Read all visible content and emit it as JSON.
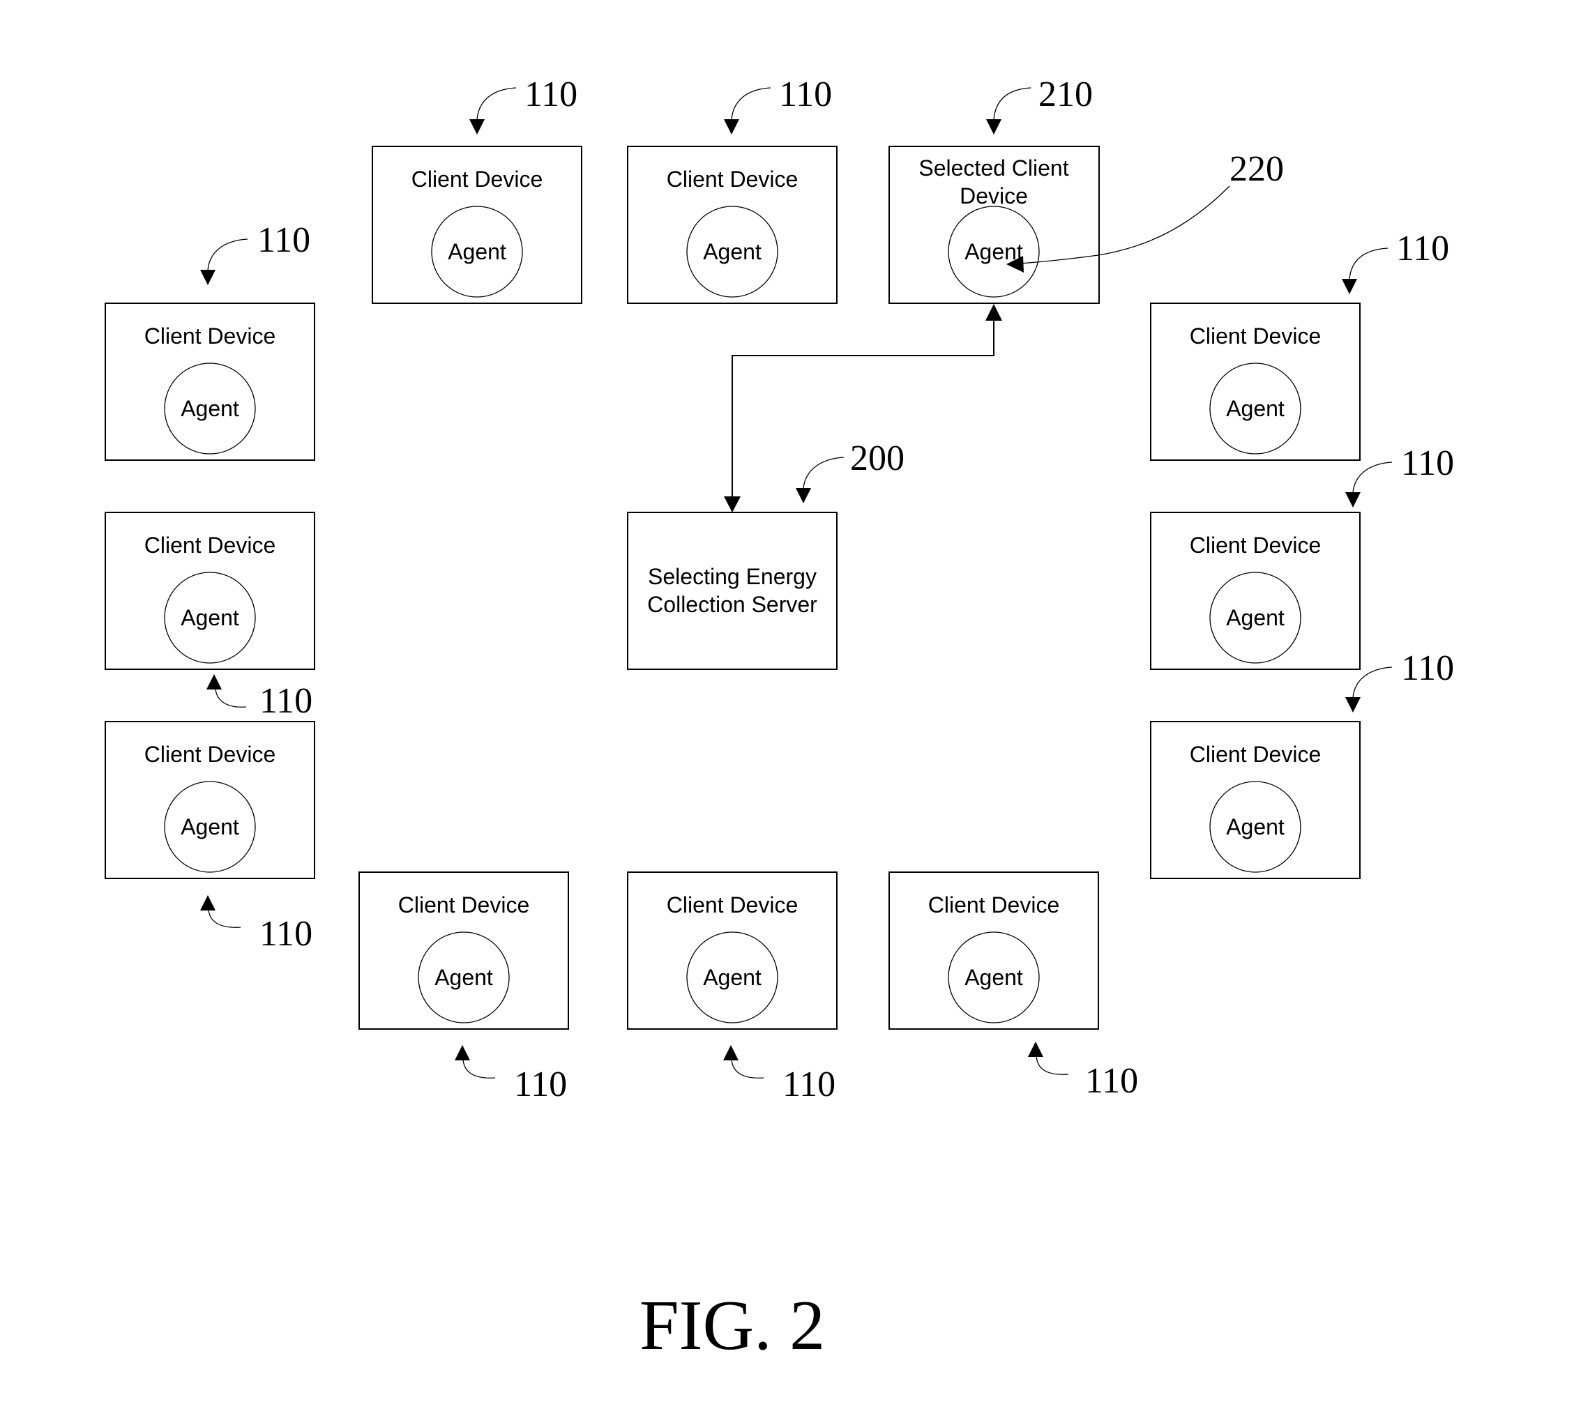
{
  "figure": {
    "caption": "FIG. 2"
  },
  "server": {
    "ref": "200",
    "label_lines": [
      "Selecting Energy",
      "Collection Server"
    ]
  },
  "selected_device": {
    "ref": "210",
    "label_lines": [
      "Selected Client",
      "Device"
    ],
    "agent_label": "Agent",
    "agent_ref": "220"
  },
  "client_devices": [
    {
      "id": "top-1",
      "ref": "110",
      "label": "Client Device",
      "agent_label": "Agent"
    },
    {
      "id": "top-2",
      "ref": "110",
      "label": "Client Device",
      "agent_label": "Agent"
    },
    {
      "id": "left-1",
      "ref": "110",
      "label": "Client Device",
      "agent_label": "Agent"
    },
    {
      "id": "left-2",
      "ref": "110",
      "label": "Client Device",
      "agent_label": "Agent"
    },
    {
      "id": "left-3",
      "ref": "110",
      "label": "Client Device",
      "agent_label": "Agent"
    },
    {
      "id": "right-1",
      "ref": "110",
      "label": "Client Device",
      "agent_label": "Agent"
    },
    {
      "id": "right-2",
      "ref": "110",
      "label": "Client Device",
      "agent_label": "Agent"
    },
    {
      "id": "right-3",
      "ref": "110",
      "label": "Client Device",
      "agent_label": "Agent"
    },
    {
      "id": "bottom-1",
      "ref": "110",
      "label": "Client Device",
      "agent_label": "Agent"
    },
    {
      "id": "bottom-2",
      "ref": "110",
      "label": "Client Device",
      "agent_label": "Agent"
    },
    {
      "id": "bottom-3",
      "ref": "110",
      "label": "Client Device",
      "agent_label": "Agent"
    }
  ],
  "connections": [
    {
      "from": "server",
      "to": "selected_device",
      "bidirectional": true
    }
  ]
}
